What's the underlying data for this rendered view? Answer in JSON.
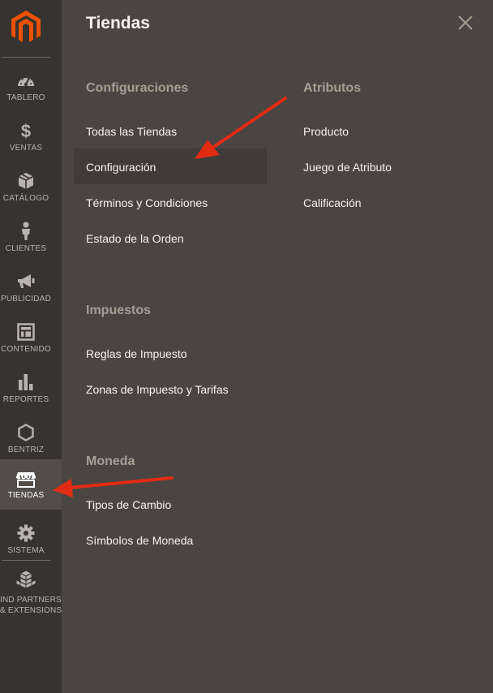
{
  "sidebar": {
    "items": [
      {
        "label": "TABLERO",
        "icon": "dashboard-icon"
      },
      {
        "label": "VENTAS",
        "icon": "dollar-icon"
      },
      {
        "label": "CATÁLOGO",
        "icon": "box-icon"
      },
      {
        "label": "CLIENTES",
        "icon": "person-icon"
      },
      {
        "label": "PUBLICIDAD",
        "icon": "megaphone-icon"
      },
      {
        "label": "CONTENIDO",
        "icon": "layout-icon"
      },
      {
        "label": "REPORTES",
        "icon": "bar-chart-icon"
      },
      {
        "label": "BENTRIZ",
        "icon": "hexagon-icon"
      },
      {
        "label": "TIENDAS",
        "icon": "store-icon",
        "active": true
      },
      {
        "label": "SISTEMA",
        "icon": "gear-icon"
      },
      {
        "label_line1": "IND PARTNERS",
        "label_line2": "& EXTENSIONS",
        "icon": "blocks-icon"
      }
    ]
  },
  "panel": {
    "title": "Tiendas",
    "close_icon": "close-icon",
    "groups": [
      {
        "title": "Configuraciones",
        "links": [
          "Todas las Tiendas",
          "Configuración",
          "Términos y Condiciones",
          "Estado de la Orden"
        ]
      },
      {
        "title": "Atributos",
        "links": [
          "Producto",
          "Juego de Atributo",
          "Calificación"
        ]
      },
      {
        "title": "Impuestos",
        "links": [
          "Reglas de Impuesto",
          "Zonas de Impuesto y Tarifas"
        ]
      },
      {
        "title": "Moneda",
        "links": [
          "Tipos de Cambio",
          "Símbolos de Moneda"
        ]
      }
    ]
  },
  "colors": {
    "sidebar_bg": "#373330",
    "panel_bg": "#4a4542",
    "logo": "#eb5202",
    "annotation_arrow": "#e22b13",
    "group_title": "#a79d95",
    "link_text": "#f7f3eb"
  }
}
